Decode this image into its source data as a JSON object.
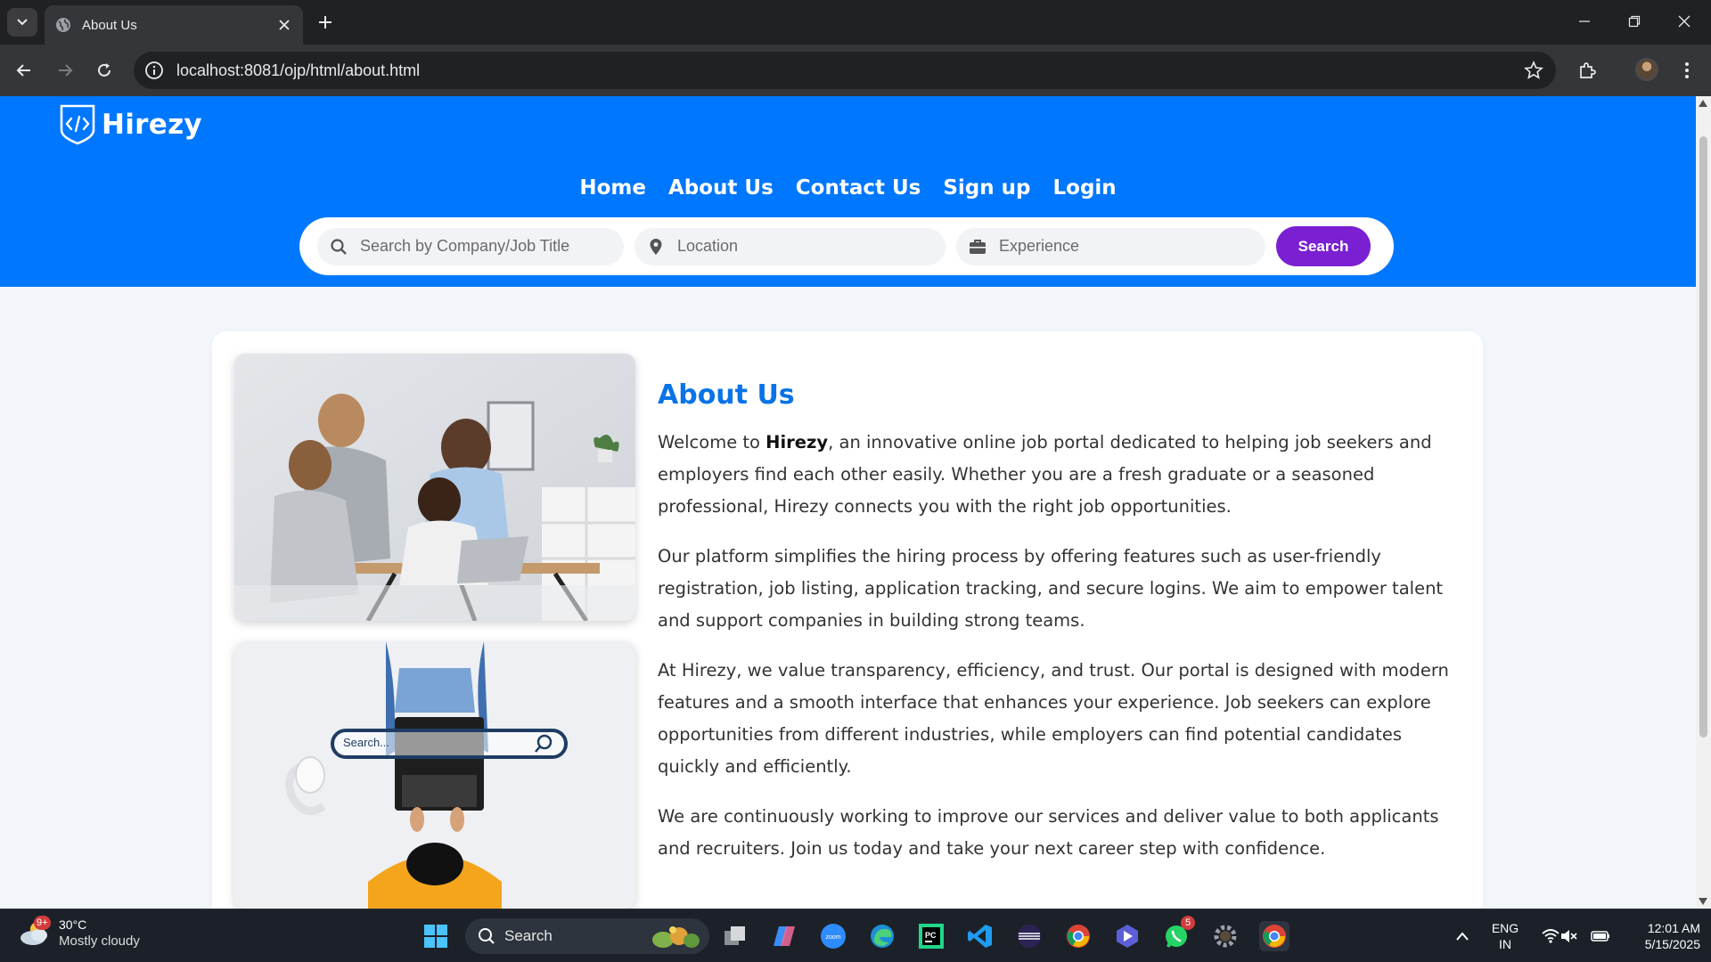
{
  "browser": {
    "tab_title": "About Us",
    "url": "localhost:8081/ojp/html/about.html"
  },
  "site": {
    "brand": "Hirezy",
    "nav": [
      "Home",
      "About Us",
      "Contact Us",
      "Sign up",
      "Login"
    ],
    "search": {
      "company_placeholder": "Search by Company/Job Title",
      "location_placeholder": "Location",
      "experience_placeholder": "Experience",
      "button": "Search"
    },
    "colors": {
      "header": "#0077ff",
      "search_button": "#7a1fd1",
      "heading": "#0a73e8"
    }
  },
  "about": {
    "heading": "About Us",
    "p1_before": "Welcome to ",
    "p1_bold": "Hirezy",
    "p1_after": ", an innovative online job portal dedicated to helping job seekers and employers find each other easily. Whether you are a fresh graduate or a seasoned professional, Hirezy connects you with the right job opportunities.",
    "p2": "Our platform simplifies the hiring process by offering features such as user-friendly registration, job listing, application tracking, and secure logins. We aim to empower talent and support companies in building strong teams.",
    "p3": "At Hirezy, we value transparency, efficiency, and trust. Our portal is designed with modern features and a smooth interface that enhances your experience. Job seekers can explore opportunities from different industries, while employers can find potential candidates quickly and efficiently.",
    "p4": "We are continuously working to improve our services and deliver value to both applicants and recruiters. Join us today and take your next career step with confidence.",
    "image2_search_text": "Search..."
  },
  "taskbar": {
    "temperature": "30°C",
    "weather": "Mostly cloudy",
    "weather_badge": "9+",
    "search_label": "Search",
    "whatsapp_badge": "5",
    "lang1": "ENG",
    "lang2": "IN",
    "time": "12:01 AM",
    "date": "5/15/2025"
  }
}
